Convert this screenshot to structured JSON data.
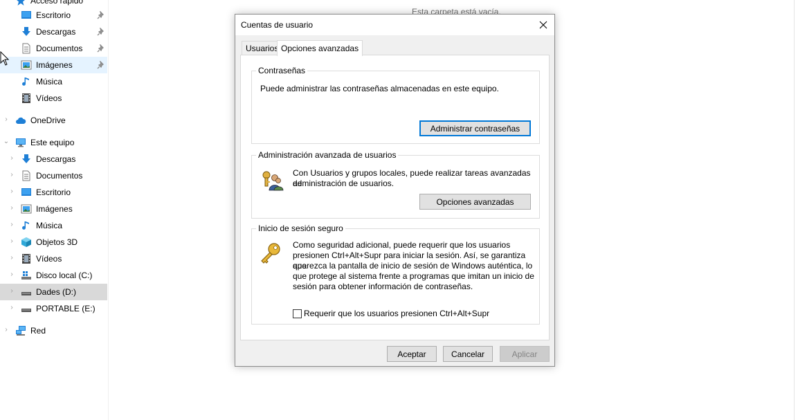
{
  "explorer": {
    "empty_folder_message": "Esta carpeta está vacía.",
    "quick_access_label": "Acceso rápido",
    "quick_access": [
      {
        "label": "Escritorio",
        "icon": "desktop-icon",
        "pinned": true
      },
      {
        "label": "Descargas",
        "icon": "downloads-icon",
        "pinned": true
      },
      {
        "label": "Documentos",
        "icon": "documents-icon",
        "pinned": true
      },
      {
        "label": "Imágenes",
        "icon": "pictures-icon",
        "pinned": true,
        "selected": true
      },
      {
        "label": "Música",
        "icon": "music-icon"
      },
      {
        "label": "Vídeos",
        "icon": "videos-icon"
      }
    ],
    "onedrive": {
      "label": "OneDrive",
      "icon": "cloud-icon"
    },
    "this_pc": {
      "label": "Este equipo",
      "icon": "computer-icon"
    },
    "this_pc_items": [
      {
        "label": "Descargas",
        "icon": "downloads-icon"
      },
      {
        "label": "Documentos",
        "icon": "documents-icon"
      },
      {
        "label": "Escritorio",
        "icon": "desktop-icon"
      },
      {
        "label": "Imágenes",
        "icon": "pictures-icon"
      },
      {
        "label": "Música",
        "icon": "music-icon"
      },
      {
        "label": "Objetos 3D",
        "icon": "objects-3d-icon"
      },
      {
        "label": "Vídeos",
        "icon": "videos-icon"
      },
      {
        "label": "Disco local (C:)",
        "icon": "windows-drive-icon"
      },
      {
        "label": "Dades (D:)",
        "icon": "drive-icon",
        "highlighted": true
      },
      {
        "label": "PORTABLE (E:)",
        "icon": "drive-icon"
      }
    ],
    "network": {
      "label": "Red",
      "icon": "network-icon"
    }
  },
  "dialog": {
    "title": "Cuentas de usuario",
    "tabs": [
      {
        "label": "Usuarios",
        "active": false
      },
      {
        "label": "Opciones avanzadas",
        "active": true
      }
    ],
    "passwords": {
      "legend": "Contraseñas",
      "text": "Puede administrar las contraseñas almacenadas en este equipo.",
      "button": "Administrar contraseñas"
    },
    "advanced": {
      "legend": "Administración avanzada de usuarios",
      "text_line1": "Con Usuarios y grupos locales, puede realizar tareas avanzadas de",
      "text_line2": "administración de usuarios.",
      "button": "Opciones avanzadas"
    },
    "secure_logon": {
      "legend": "Inicio de sesión seguro",
      "lines": [
        "Como seguridad adicional, puede requerir que los usuarios",
        "presionen Ctrl+Alt+Supr para iniciar la sesión. Así, se garantiza que",
        "aparezca la pantalla de inicio de sesión de Windows auténtica, lo",
        "que protege al sistema frente a programas que imitan un inicio de",
        "sesión para obtener información de contraseñas."
      ],
      "checkbox_label": "Requerir que los usuarios presionen Ctrl+Alt+Supr",
      "checkbox_checked": false
    },
    "buttons": {
      "ok": "Aceptar",
      "cancel": "Cancelar",
      "apply": "Aplicar"
    }
  }
}
